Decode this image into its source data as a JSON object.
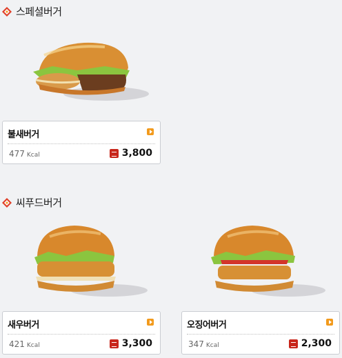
{
  "sections": [
    {
      "title": "스페셜버거",
      "items": [
        {
          "name": "불새버거",
          "kcal": "477",
          "kcal_unit": "Kcal",
          "price": "3,800"
        }
      ]
    },
    {
      "title": "씨푸드버거",
      "items": [
        {
          "name": "새우버거",
          "kcal": "421",
          "kcal_unit": "Kcal",
          "price": "3,300"
        },
        {
          "name": "오징어버거",
          "kcal": "347",
          "kcal_unit": "Kcal",
          "price": "2,300"
        }
      ]
    }
  ],
  "colors": {
    "accent_orange": "#f29a1c",
    "price_icon_red": "#c8261b",
    "diamond_red": "#e0412a",
    "diamond_orange": "#f3a32b"
  },
  "icons": {
    "section_marker": "diamond-icon",
    "detail_arrow": "arrow-right-icon",
    "price_marker": "won-icon"
  }
}
